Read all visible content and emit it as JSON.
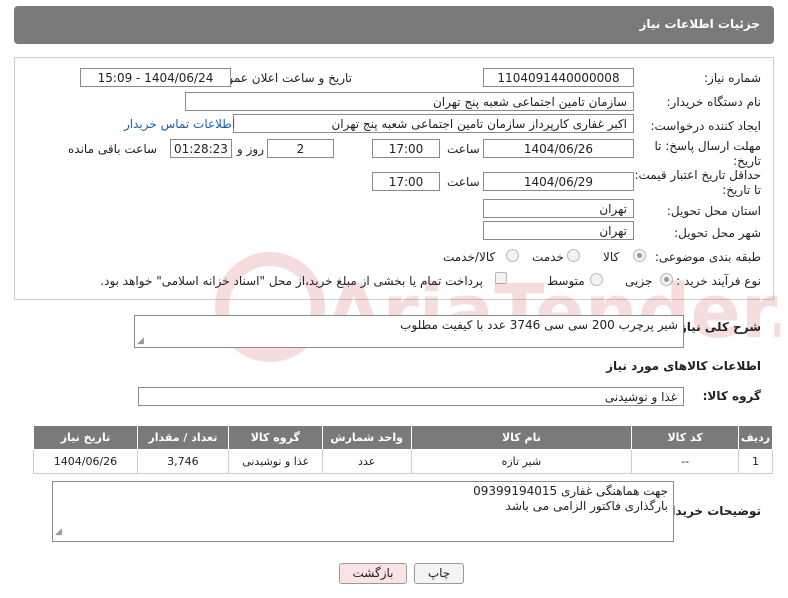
{
  "header": {
    "title": "جزئیات اطلاعات نیاز"
  },
  "fields": {
    "need_number_label": "شماره نیاز:",
    "need_number": "1104091440000008",
    "announce_label": "تاریخ و ساعت اعلان عمومی:",
    "announce_value": "1404/06/24 - 15:09",
    "buyer_org_label": "نام دستگاه خریدار:",
    "buyer_org": "سازمان تامین اجتماعی شعبه پنج تهران",
    "requester_label": "ایجاد کننده درخواست:",
    "requester": "اکبر غفاری کارپرداز  سازمان تامین اجتماعی شعبه پنج تهران",
    "contact_link": "اطلاعات تماس خریدار",
    "reply_deadline_label": "مهلت ارسال پاسخ: تا تاریخ:",
    "reply_date": "1404/06/26",
    "time_label": "ساعت",
    "reply_time": "17:00",
    "days_value": "2",
    "days_label": "روز و",
    "remaining_time": "01:28:23",
    "remaining_label": "ساعت باقی مانده",
    "price_validity_label": "حداقل تاریخ اعتبار قیمت: تا تاریخ:",
    "price_date": "1404/06/29",
    "price_time": "17:00",
    "province_label": "استان محل تحویل:",
    "province": "تهران",
    "city_label": "شهر محل تحویل:",
    "city": "تهران",
    "category_label": "طبقه بندی موضوعی:",
    "category_options": [
      "کالا",
      "خدمت",
      "کالا/خدمت"
    ],
    "process_label": "نوع فرآیند خرید :",
    "process_options": [
      "جزیی",
      "متوسط"
    ],
    "payment_note": "پرداخت تمام یا بخشی از مبلغ خرید،از محل \"اسناد خزانه اسلامی\" خواهد بود."
  },
  "description": {
    "label": "شرح کلی نیاز:",
    "value": "شیر پرچرب 200 سی سی    3746 عدد با کیفیت مطلوب"
  },
  "goods": {
    "section_title": "اطلاعات کالاهای مورد نیاز",
    "group_label": "گروه کالا:",
    "group_value": "غذا و نوشیدنی"
  },
  "table": {
    "headers": [
      "ردیف",
      "کد کالا",
      "نام کالا",
      "واحد شمارش",
      "گروه کالا",
      "تعداد / مقدار",
      "تاریخ نیاز"
    ],
    "rows": [
      [
        "1",
        "--",
        "شیر تازه",
        "عدد",
        "غذا و نوشیدنی",
        "3,746",
        "1404/06/26"
      ]
    ]
  },
  "buyer_notes": {
    "label": "توضیحات خریدار:",
    "line1": "جهت هماهنگی غفاری 09399194015",
    "line2": "بارگذاری فاکتور الزامی می باشد"
  },
  "buttons": {
    "print": "چاپ",
    "back": "بازگشت"
  },
  "watermark_text": "AriaTender.net"
}
